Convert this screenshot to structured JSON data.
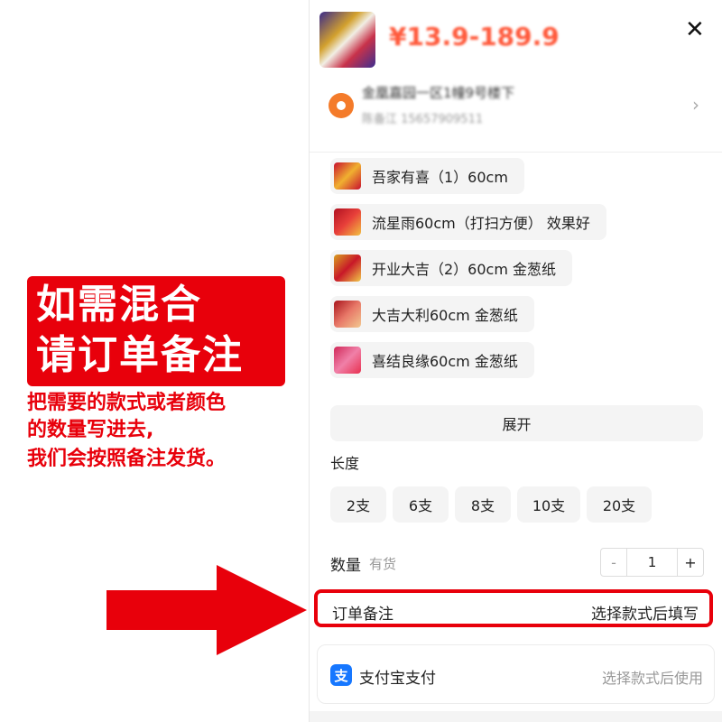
{
  "banner": {
    "line1": "如需混合",
    "line2": "请订单备注",
    "bg_color": "#e8000b"
  },
  "note": {
    "line1": "把需要的款式或者颜色",
    "line2": "的数量写进去,",
    "line3": "我们会按照备注发货。",
    "color": "#e8000b"
  },
  "product": {
    "price": "¥13.9-189.9"
  },
  "address": {
    "line1": "金凰嘉园一区1幢9号楼下",
    "line2": "陈备江 15657909511"
  },
  "styles": [
    {
      "label": "吾家有喜（1）60cm"
    },
    {
      "label": "流星雨60cm（打扫方便） 效果好"
    },
    {
      "label": "开业大吉（2）60cm 金葱纸"
    },
    {
      "label": "大吉大利60cm 金葱纸"
    },
    {
      "label": "喜结良缘60cm 金葱纸"
    }
  ],
  "expand_label": "展开",
  "length": {
    "title": "长度",
    "options": [
      "2支",
      "6支",
      "8支",
      "10支",
      "20支"
    ]
  },
  "quantity": {
    "label": "数量",
    "stock": "有货",
    "minus": "-",
    "value": "1",
    "plus": "+"
  },
  "remark": {
    "label": "订单备注",
    "hint": "选择款式后填写"
  },
  "payment": {
    "icon_char": "支",
    "label": "支付宝支付",
    "hint": "选择款式后使用"
  },
  "icons": {
    "close": "✕",
    "chevron": "›"
  }
}
